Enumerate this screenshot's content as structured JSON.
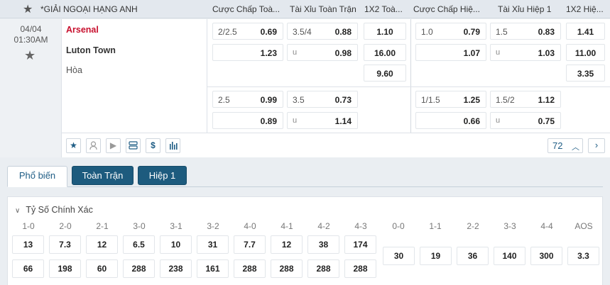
{
  "header": {
    "league": "*GIẢI NGOẠI HẠNG ANH",
    "columns": [
      "Cược Chấp Toà...",
      "Tài Xỉu Toàn Trận",
      "1X2 Toà...",
      "Cược Chấp Hiệ...",
      "Tài Xỉu Hiệp 1",
      "1X2 Hiệ..."
    ]
  },
  "match": {
    "date": "04/04",
    "time": "01:30AM",
    "home": "Arsenal",
    "away": "Luton Town",
    "draw": "Hòa",
    "row1": {
      "ah_ft": {
        "home_hcp": "2/2.5",
        "home": "0.69",
        "away": "1.23"
      },
      "ou_ft": {
        "line": "3.5/4",
        "over": "0.88",
        "under_label": "u",
        "under": "0.98"
      },
      "x12_ft": {
        "home": "1.10",
        "away": "16.00",
        "draw": "9.60"
      },
      "ah_1h": {
        "home_hcp": "1.0",
        "home": "0.79",
        "away": "1.07"
      },
      "ou_1h": {
        "line": "1.5",
        "over": "0.83",
        "under_label": "u",
        "under": "1.03"
      },
      "x12_1h": {
        "home": "1.41",
        "away": "11.00",
        "draw": "3.35"
      }
    },
    "row2": {
      "ah_ft": {
        "home_hcp": "2.5",
        "home": "0.99",
        "away": "0.89"
      },
      "ou_ft": {
        "line": "3.5",
        "over": "0.73",
        "under_label": "u",
        "under": "1.14"
      },
      "ah_1h": {
        "home_hcp": "1/1.5",
        "home": "1.25",
        "away": "0.66"
      },
      "ou_1h": {
        "line": "1.5/2",
        "over": "1.12",
        "under_label": "u",
        "under": "0.75"
      }
    },
    "more_count": "72"
  },
  "tabs": [
    "Phổ biến",
    "Toàn Trận",
    "Hiệp 1"
  ],
  "exact_score": {
    "title": "Tỷ Số Chính Xác",
    "labels": [
      "1-0",
      "2-0",
      "2-1",
      "3-0",
      "3-1",
      "3-2",
      "4-0",
      "4-1",
      "4-2",
      "4-3",
      "0-0",
      "1-1",
      "2-2",
      "3-3",
      "4-4",
      "AOS"
    ],
    "home_row": [
      "13",
      "7.3",
      "12",
      "6.5",
      "10",
      "31",
      "7.7",
      "12",
      "38",
      "174"
    ],
    "away_row": [
      "66",
      "198",
      "60",
      "288",
      "238",
      "161",
      "288",
      "288",
      "288",
      "288"
    ],
    "draw_row": [
      "30",
      "19",
      "36",
      "140",
      "300",
      "3.3"
    ]
  },
  "colors": {
    "home_team": "#c8102e",
    "tab_active_text": "#1f5d85",
    "tab_bg": "#1d5b7e"
  }
}
